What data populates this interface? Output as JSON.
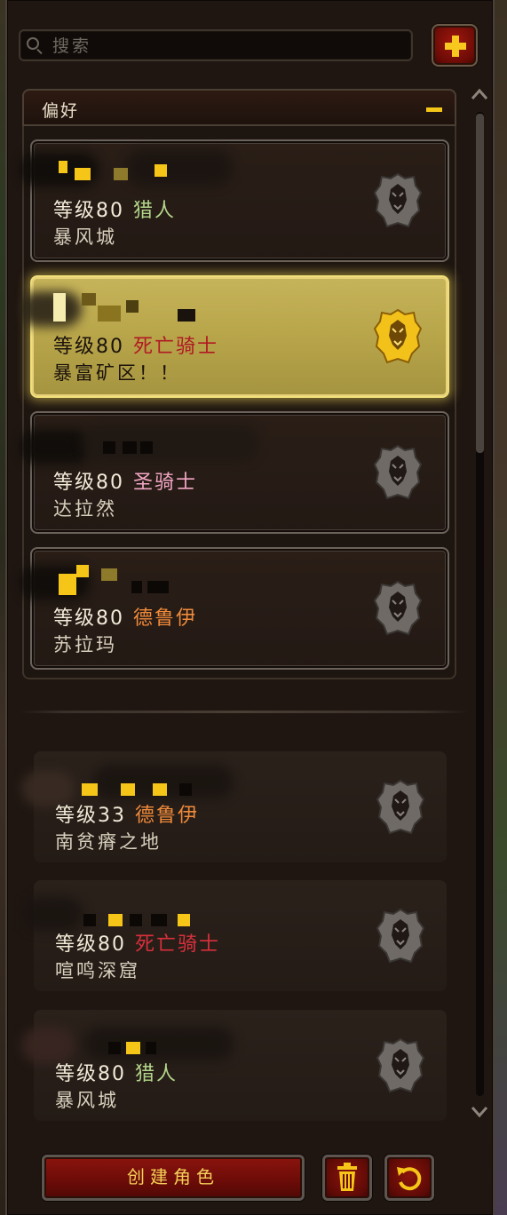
{
  "search": {
    "placeholder": "搜索"
  },
  "favorites_group": {
    "title": "偏好"
  },
  "favorites": [
    {
      "level_label": "等级80",
      "class": "猎人",
      "location": "暴风城",
      "class_color": "#b3d68a",
      "faction": "alliance"
    },
    {
      "level_label": "等级80",
      "class": "死亡骑士",
      "location": "暴富矿区！！",
      "class_color": "#d8303c",
      "faction": "alliance",
      "selected": true
    },
    {
      "level_label": "等级80",
      "class": "圣骑士",
      "location": "达拉然",
      "class_color": "#f2a6c4",
      "faction": "alliance"
    },
    {
      "level_label": "等级80",
      "class": "德鲁伊",
      "location": "苏拉玛",
      "class_color": "#f08a3a",
      "faction": "alliance"
    }
  ],
  "others": [
    {
      "level_label": "等级33",
      "class": "德鲁伊",
      "location": "南贫瘠之地",
      "class_color": "#f08a3a",
      "faction": "alliance"
    },
    {
      "level_label": "等级80",
      "class": "死亡骑士",
      "location": "喧鸣深窟",
      "class_color": "#d8303c",
      "faction": "alliance"
    },
    {
      "level_label": "等级80",
      "class": "猎人",
      "location": "暴风城",
      "class_color": "#b3d68a",
      "faction": "alliance"
    }
  ],
  "footer": {
    "create_label": "创建角色"
  },
  "icons": {
    "search": "search-icon",
    "add": "plus-icon",
    "collapse": "minus-icon",
    "emblem": "alliance-lion-icon",
    "delete": "trash-icon",
    "undo": "undo-icon"
  },
  "colors": {
    "gold": "#f5c518",
    "button_red": "#8b140e",
    "selected_card": "#c6b45a"
  }
}
